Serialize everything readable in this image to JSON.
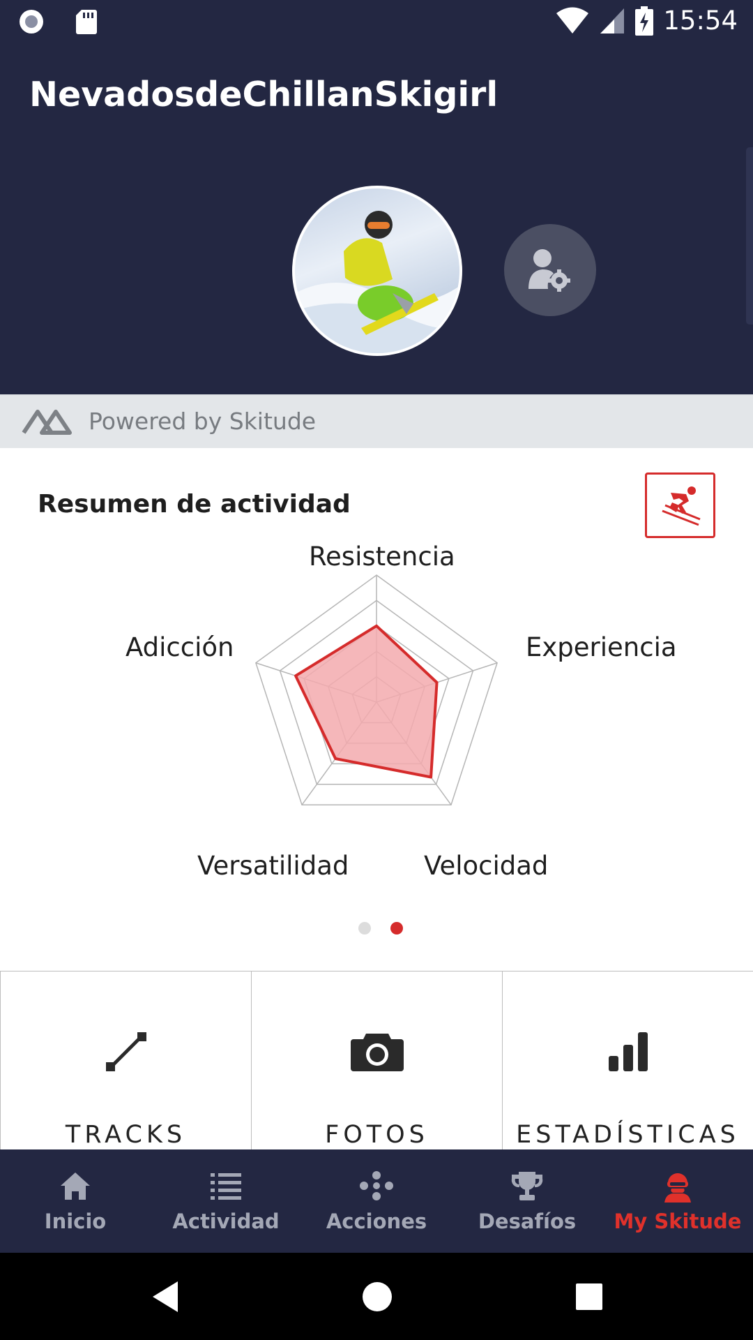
{
  "status_bar": {
    "time": "15:54"
  },
  "header": {
    "title": "NevadosdeChillanSkigirl"
  },
  "powered_by": {
    "text": "Powered by Skitude"
  },
  "summary": {
    "title": "Resumen de actividad",
    "radar": {
      "labels": [
        "Resistencia",
        "Experiencia",
        "Velocidad",
        "Versatilidad",
        "Adicción"
      ],
      "values": [
        0.6,
        0.5,
        0.73,
        0.55,
        0.67
      ],
      "max": 1,
      "rings": 5,
      "stroke_color": "#d52b2b",
      "fill_color": "#f3aaae",
      "grid_color": "#b5b5b5"
    },
    "pager": {
      "total": 2,
      "active": 1
    }
  },
  "tiles": [
    {
      "label": "TRACKS",
      "icon": "track-line-icon"
    },
    {
      "label": "FOTOS",
      "icon": "camera-icon"
    },
    {
      "label": "ESTADÍSTICAS",
      "icon": "bar-chart-icon"
    }
  ],
  "bottom_nav": [
    {
      "label": "Inicio",
      "icon": "home-icon",
      "active": false
    },
    {
      "label": "Actividad",
      "icon": "list-icon",
      "active": false
    },
    {
      "label": "Acciones",
      "icon": "actions-icon",
      "active": false
    },
    {
      "label": "Desafíos",
      "icon": "trophy-icon",
      "active": false
    },
    {
      "label": "My Skitude",
      "icon": "skier-avatar-icon",
      "active": true
    }
  ],
  "colors": {
    "navy": "#232742",
    "accent_red": "#d52b2b",
    "nav_inactive": "#a4a8b6"
  }
}
